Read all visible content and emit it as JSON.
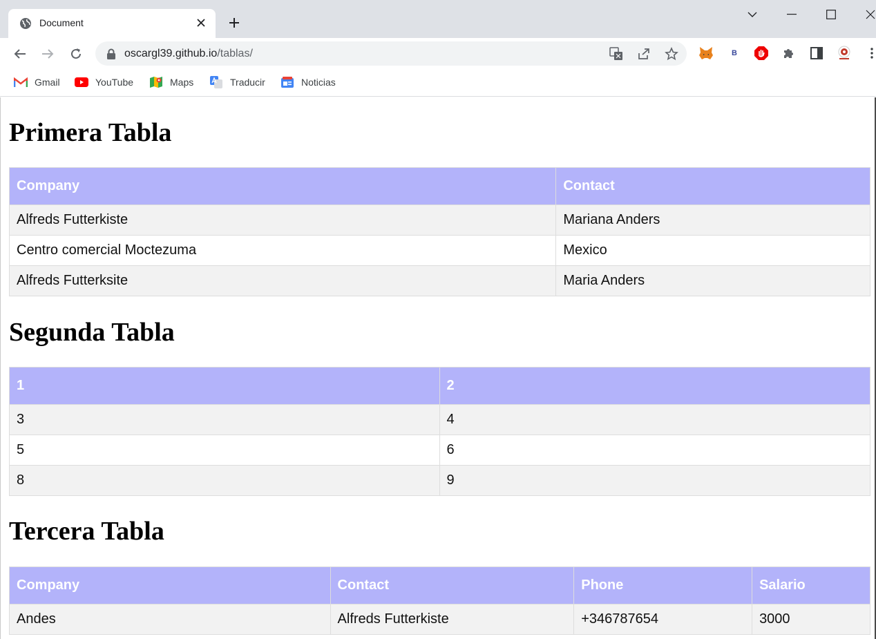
{
  "browser": {
    "tab_title": "Document",
    "url_host": "oscargl39.github.io",
    "url_path": "/tablas/",
    "bookmarks": [
      {
        "label": "Gmail",
        "icon": "gmail-icon"
      },
      {
        "label": "YouTube",
        "icon": "youtube-icon"
      },
      {
        "label": "Maps",
        "icon": "maps-icon"
      },
      {
        "label": "Traducir",
        "icon": "translate-icon"
      },
      {
        "label": "Noticias",
        "icon": "news-icon"
      }
    ],
    "extension_b_label": "B"
  },
  "page": {
    "table1": {
      "title": "Primera Tabla",
      "headers": [
        "Company",
        "Contact"
      ],
      "rows": [
        [
          "Alfreds Futterkiste",
          "Mariana Anders"
        ],
        [
          "Centro comercial Moctezuma",
          "Mexico"
        ],
        [
          "Alfreds Futterksite",
          "Maria Anders"
        ]
      ]
    },
    "table2": {
      "title": "Segunda Tabla",
      "headers": [
        "1",
        "2"
      ],
      "rows": [
        [
          "3",
          "4"
        ],
        [
          "5",
          "6"
        ],
        [
          "8",
          "9"
        ]
      ]
    },
    "table3": {
      "title": "Tercera Tabla",
      "headers": [
        "Company",
        "Contact",
        "Phone",
        "Salario"
      ],
      "rows": [
        [
          "Andes",
          "Alfreds Futterkiste",
          "+346787654",
          "3000"
        ]
      ]
    }
  },
  "colors": {
    "header_bg": "#b3b3fa",
    "row_odd": "#f2f2f2",
    "row_even": "#ffffff"
  }
}
